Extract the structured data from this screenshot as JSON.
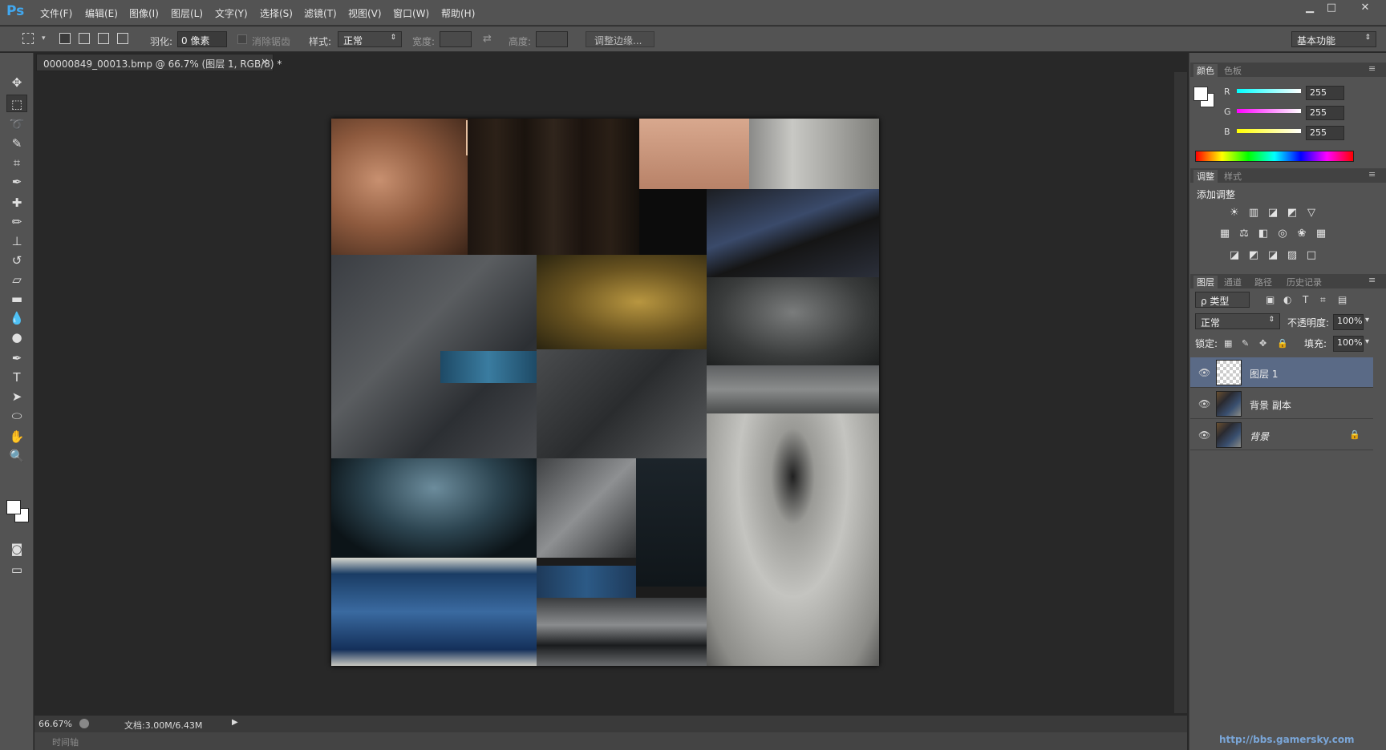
{
  "app": {
    "logo": "Ps"
  },
  "menu": [
    "文件(F)",
    "编辑(E)",
    "图像(I)",
    "图层(L)",
    "文字(Y)",
    "选择(S)",
    "滤镜(T)",
    "视图(V)",
    "窗口(W)",
    "帮助(H)"
  ],
  "window_controls": {
    "minimize": "▁",
    "maximize": "□",
    "close": "✕"
  },
  "options": {
    "feather_label": "羽化:",
    "feather_value": "0 像素",
    "antialias_label": "消除锯齿",
    "style_label": "样式:",
    "style_value": "正常",
    "width_label": "宽度:",
    "height_label": "高度:",
    "refine_edge": "调整边缘...",
    "workspace": "基本功能"
  },
  "document": {
    "tab_title": "00000849_00013.bmp @ 66.7% (图层 1, RGB/8) *",
    "close": "×",
    "zoom": "66.67%",
    "doc_size": "文档:3.00M/6.43M",
    "timeline": "时间轴"
  },
  "color_panel": {
    "tabs": [
      "颜色",
      "色板"
    ],
    "r_label": "R",
    "g_label": "G",
    "b_label": "B",
    "r": "255",
    "g": "255",
    "b": "255"
  },
  "adjust_panel": {
    "tabs": [
      "调整",
      "样式"
    ],
    "title": "添加调整",
    "row1": [
      "☀",
      "▥",
      "◪",
      "◩",
      "▽"
    ],
    "row2": [
      "▦",
      "⚖",
      "◧",
      "◎",
      "❀",
      "▦"
    ],
    "row3": [
      "◪",
      "◩",
      "◪",
      "▨",
      "□"
    ]
  },
  "layers_panel": {
    "tabs": [
      "图层",
      "通道",
      "路径",
      "历史记录"
    ],
    "filter_label": "ρ 类型",
    "blend_mode": "正常",
    "opacity_label": "不透明度:",
    "opacity": "100%",
    "lock_label": "锁定:",
    "fill_label": "填充:",
    "fill": "100%",
    "layers": [
      {
        "name": "图层 1",
        "selected": true
      },
      {
        "name": "背景 副本",
        "selected": false
      },
      {
        "name": "背景",
        "selected": false,
        "locked": true
      }
    ]
  },
  "watermark": "http://bbs.gamersky.com",
  "colors": {
    "ui_bg": "#535353",
    "workspace_bg": "#282828",
    "ps_blue": "#41a8f0",
    "selected_layer": "#5a6a86"
  }
}
